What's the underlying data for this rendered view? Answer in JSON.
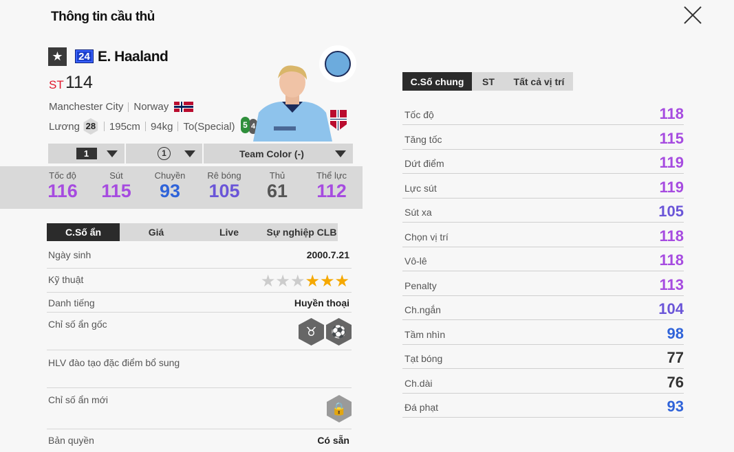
{
  "header": {
    "title": "Thông tin cầu thủ",
    "close_icon": "close-icon"
  },
  "player": {
    "star_icon": "★",
    "season": "24",
    "name": "E. Haaland",
    "position": "ST",
    "ovr": "114",
    "club": "Manchester City",
    "nation": "Norway",
    "salary_label": "Lương",
    "salary": "28",
    "height": "195cm",
    "weight": "94kg",
    "body": "To(Special)",
    "foot_left": "5",
    "foot_right": "4"
  },
  "selectors": {
    "level": "1",
    "training": "1",
    "team_color": "Team Color (-)"
  },
  "summary_stats": [
    {
      "label": "Tốc độ",
      "value": "116",
      "color": "#a64be0"
    },
    {
      "label": "Sút",
      "value": "115",
      "color": "#a64be0"
    },
    {
      "label": "Chuyền",
      "value": "93",
      "color": "#2f63d9"
    },
    {
      "label": "Rê bóng",
      "value": "105",
      "color": "#6a55d8"
    },
    {
      "label": "Thủ",
      "value": "61",
      "color": "#555555"
    },
    {
      "label": "Thể lực",
      "value": "112",
      "color": "#a64be0"
    }
  ],
  "hidden_tabs": [
    "C.Số ẩn",
    "Giá",
    "Live",
    "Sự nghiệp CLB"
  ],
  "hidden": {
    "birth_label": "Ngày sinh",
    "birth": "2000.7.21",
    "skill_label": "Kỹ thuật",
    "skill_stars": 3,
    "fame_label": "Danh tiếng",
    "fame": "Huyền thoại",
    "orig_traits_label": "Chỉ số ẩn gốc",
    "coach_label": "HLV đào tạo đặc điểm bổ sung",
    "new_traits_label": "Chỉ số ẩn mới",
    "license_label": "Bản quyền",
    "license": "Có sẵn"
  },
  "stat_tabs": [
    "C.Số chung",
    "ST",
    "Tất cả vị trí"
  ],
  "detail_stats": [
    {
      "label": "Tốc độ",
      "value": "118",
      "cls": "c-purple"
    },
    {
      "label": "Tăng tốc",
      "value": "115",
      "cls": "c-purple"
    },
    {
      "label": "Dứt điểm",
      "value": "119",
      "cls": "c-purple"
    },
    {
      "label": "Lực sút",
      "value": "119",
      "cls": "c-purple"
    },
    {
      "label": "Sút xa",
      "value": "105",
      "cls": "c-violet"
    },
    {
      "label": "Chọn vị trí",
      "value": "118",
      "cls": "c-purple"
    },
    {
      "label": "Vô-lê",
      "value": "118",
      "cls": "c-purple"
    },
    {
      "label": "Penalty",
      "value": "113",
      "cls": "c-purple"
    },
    {
      "label": "Ch.ngắn",
      "value": "104",
      "cls": "c-violet"
    },
    {
      "label": "Tầm nhìn",
      "value": "98",
      "cls": "c-blue"
    },
    {
      "label": "Tạt bóng",
      "value": "77",
      "cls": "c-dark"
    },
    {
      "label": "Ch.dài",
      "value": "76",
      "cls": "c-dark"
    },
    {
      "label": "Đá phạt",
      "value": "93",
      "cls": "c-blue"
    }
  ]
}
